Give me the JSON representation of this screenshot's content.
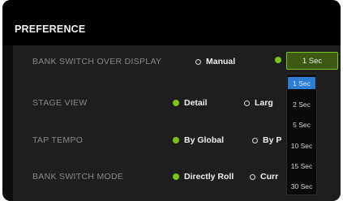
{
  "preference": {
    "title": "PREFERENCE",
    "rows": [
      {
        "label": "BANK SWITCH OVER DISPLAY",
        "options": [
          "Manual"
        ]
      },
      {
        "label": "STAGE VIEW",
        "options": [
          "Detail",
          "Larg"
        ]
      },
      {
        "label": "TAP TEMPO",
        "options": [
          "By Global",
          "By P"
        ]
      },
      {
        "label": "BANK SWITCH MODE",
        "options": [
          "Directly Roll",
          "Curr"
        ]
      }
    ],
    "timer_select": {
      "value": "1 Sec",
      "options": [
        "1 Sec",
        "2 Sec",
        "5 Sec",
        "10 Sec",
        "15 Sec",
        "30 Sec"
      ],
      "selected_index": 0
    }
  },
  "colors": {
    "accent": "#7cc318",
    "panel": "#1e1e1e",
    "header": "#000000",
    "select_bg": "#3e5a12",
    "highlight": "#2a7fd4"
  }
}
